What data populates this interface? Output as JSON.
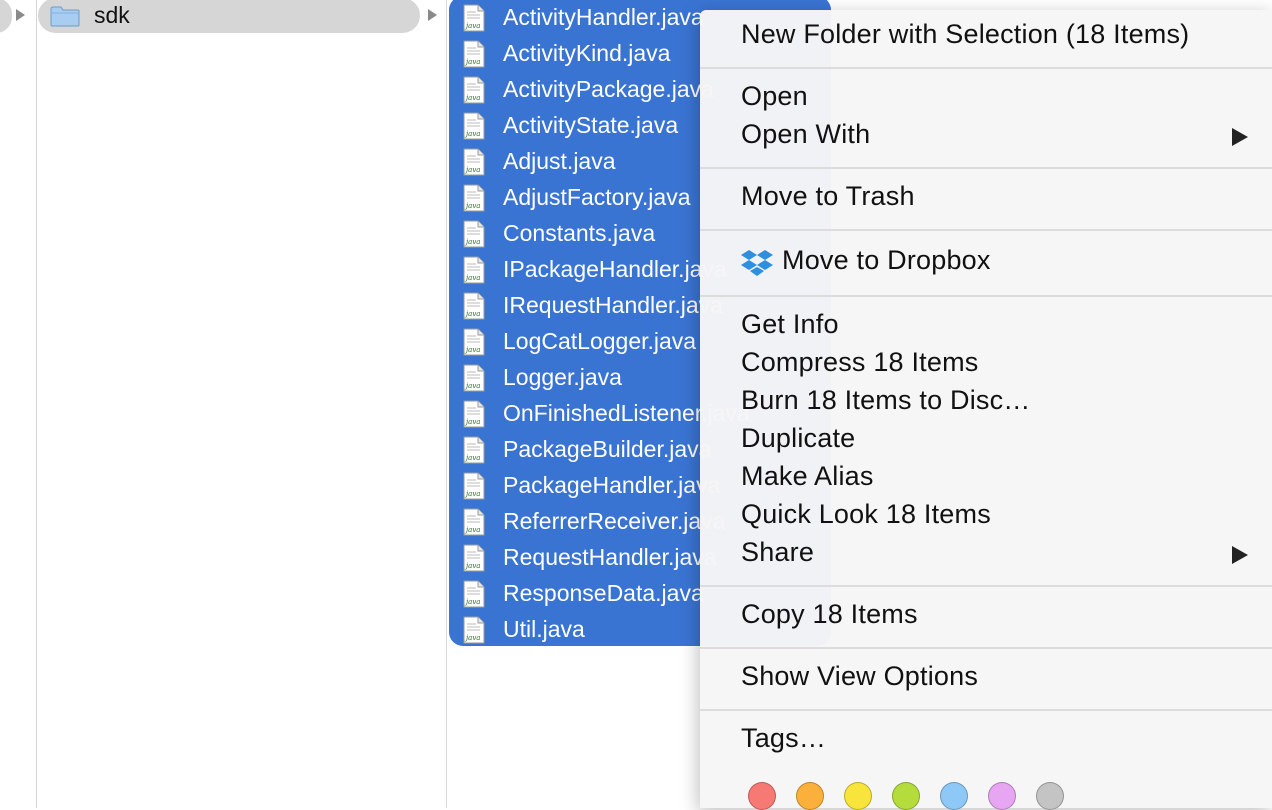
{
  "finder": {
    "parent_folder": {
      "label": "sdk",
      "icon": "folder-icon"
    },
    "files": [
      "ActivityHandler.java",
      "ActivityKind.java",
      "ActivityPackage.java",
      "ActivityState.java",
      "Adjust.java",
      "AdjustFactory.java",
      "Constants.java",
      "IPackageHandler.java",
      "IRequestHandler.java",
      "LogCatLogger.java",
      "Logger.java",
      "OnFinishedListener.java",
      "PackageBuilder.java",
      "PackageHandler.java",
      "ReferrerReceiver.java",
      "RequestHandler.java",
      "ResponseData.java",
      "Util.java"
    ],
    "file_icon": "java-file-icon",
    "selection_color": "#3a74d3"
  },
  "menu": {
    "new_folder": "New Folder with Selection (18 Items)",
    "open": "Open",
    "open_with": "Open With",
    "move_to_trash": "Move to Trash",
    "move_to_dropbox": "Move to Dropbox",
    "get_info": "Get Info",
    "compress": "Compress 18 Items",
    "burn": "Burn 18 Items to Disc…",
    "duplicate": "Duplicate",
    "make_alias": "Make Alias",
    "quick_look": "Quick Look 18 Items",
    "share": "Share",
    "copy": "Copy 18 Items",
    "show_view_options": "Show View Options",
    "tags": "Tags…",
    "tag_colors": [
      {
        "name": "red",
        "color": "#f67a73"
      },
      {
        "name": "orange",
        "color": "#fbb03b"
      },
      {
        "name": "yellow",
        "color": "#f8e43a"
      },
      {
        "name": "green",
        "color": "#b3dc3c"
      },
      {
        "name": "blue",
        "color": "#8ec8f6"
      },
      {
        "name": "purple",
        "color": "#e7a6f2"
      },
      {
        "name": "gray",
        "color": "#c4c4c4"
      }
    ]
  }
}
